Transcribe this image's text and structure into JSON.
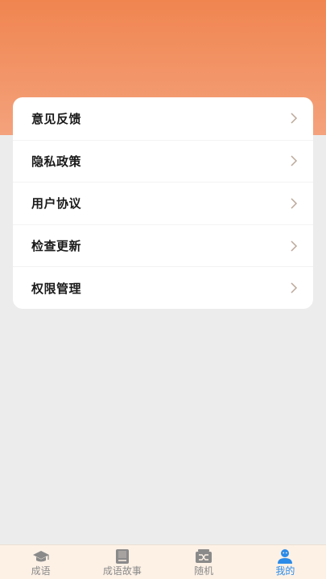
{
  "menu": {
    "items": [
      {
        "label": "意见反馈"
      },
      {
        "label": "隐私政策"
      },
      {
        "label": "用户协议"
      },
      {
        "label": "检查更新"
      },
      {
        "label": "权限管理"
      }
    ]
  },
  "tabbar": {
    "tabs": [
      {
        "label": "成语",
        "icon": "graduation-cap-icon"
      },
      {
        "label": "成语故事",
        "icon": "book-icon"
      },
      {
        "label": "随机",
        "icon": "shuffle-icon"
      },
      {
        "label": "我的",
        "icon": "user-icon"
      }
    ],
    "active_index": 3
  },
  "colors": {
    "header_gradient_top": "#f08550",
    "header_gradient_bottom": "#f4a27c",
    "active_tab": "#2b8be8",
    "inactive_tab": "#8a8a8a",
    "chevron": "#bba89a"
  }
}
